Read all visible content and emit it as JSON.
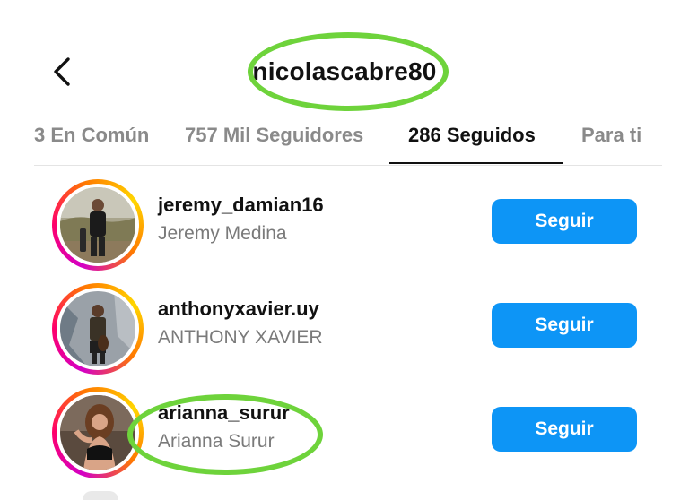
{
  "header": {
    "title": "nicolascabre80",
    "back_icon": "chevron-left-icon"
  },
  "tabs": [
    {
      "label": "3 En Común",
      "active": false
    },
    {
      "label": "757 Mil Seguidores",
      "active": false
    },
    {
      "label": "286 Seguidos",
      "active": true
    },
    {
      "label": "Para ti",
      "active": false
    }
  ],
  "users": [
    {
      "username": "jeremy_damian16",
      "full_name": "Jeremy Medina",
      "button": "Seguir"
    },
    {
      "username": "anthonyxavier.uy",
      "full_name": "ANTHONY XAVIER",
      "button": "Seguir"
    },
    {
      "username": "arianna_surur",
      "full_name": "Arianna Surur",
      "button": "Seguir"
    }
  ],
  "colors": {
    "follow_button": "#0d95f6",
    "highlight_ring": "#6ed33b",
    "story_ring": [
      "#d300c5",
      "#ff0069",
      "#ff7a00",
      "#ffd600"
    ]
  }
}
